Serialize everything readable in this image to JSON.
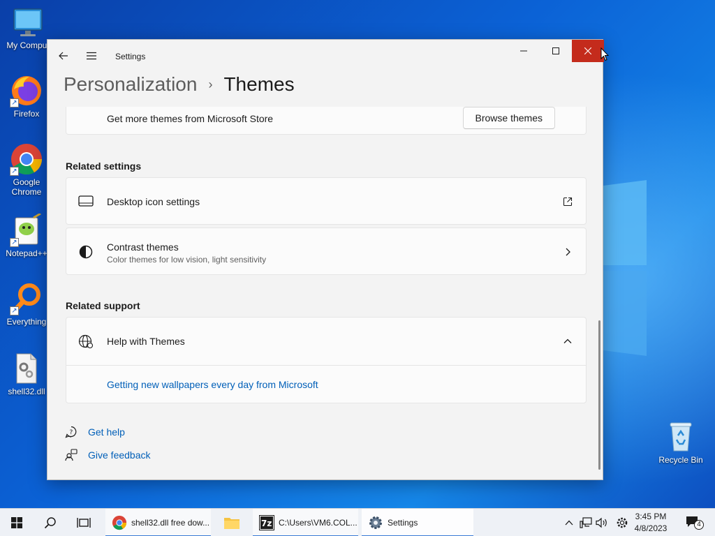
{
  "desktop": {
    "icons": [
      {
        "label": "My Comput",
        "icon": "computer-icon"
      },
      {
        "label": "Firefox",
        "icon": "firefox-icon"
      },
      {
        "label": "Google Chrome",
        "icon": "chrome-icon"
      },
      {
        "label": "Notepad++",
        "icon": "notepadpp-icon"
      },
      {
        "label": "Everything",
        "icon": "everything-icon"
      },
      {
        "label": "shell32.dll",
        "icon": "dll-file-icon"
      },
      {
        "label": "Recycle Bin",
        "icon": "recycle-bin-icon"
      }
    ]
  },
  "window": {
    "title": "Settings",
    "breadcrumb": {
      "parent": "Personalization",
      "separator": "›",
      "current": "Themes"
    },
    "store_row": {
      "label": "Get more themes from Microsoft Store",
      "button": "Browse themes"
    },
    "related_settings": {
      "title": "Related settings",
      "items": [
        {
          "label": "Desktop icon settings",
          "icon": "monitor-icon",
          "trailing": "external-link-icon"
        },
        {
          "label": "Contrast themes",
          "sublabel": "Color themes for low vision, light sensitivity",
          "icon": "contrast-icon",
          "trailing": "chevron-right-icon"
        }
      ]
    },
    "related_support": {
      "title": "Related support",
      "item": {
        "label": "Help with Themes",
        "icon": "globe-icon",
        "expanded": true
      },
      "links": [
        "Getting new wallpapers every day from Microsoft"
      ]
    },
    "footer": {
      "get_help": "Get help",
      "give_feedback": "Give feedback"
    }
  },
  "taskbar": {
    "tasks": [
      {
        "label": "shell32.dll free dow...",
        "icon": "chrome-icon"
      },
      {
        "label": "",
        "icon": "file-explorer-icon"
      },
      {
        "label": "C:\\Users\\VM6.COL...",
        "icon": "7zip-icon"
      },
      {
        "label": "Settings",
        "icon": "gear-icon"
      }
    ],
    "clock": {
      "time": "3:45 PM",
      "date": "4/8/2023"
    },
    "notification_count": "4"
  },
  "colors": {
    "accent": "#005fb8",
    "close": "#c42b1c",
    "desktop": "#0b62d6"
  }
}
